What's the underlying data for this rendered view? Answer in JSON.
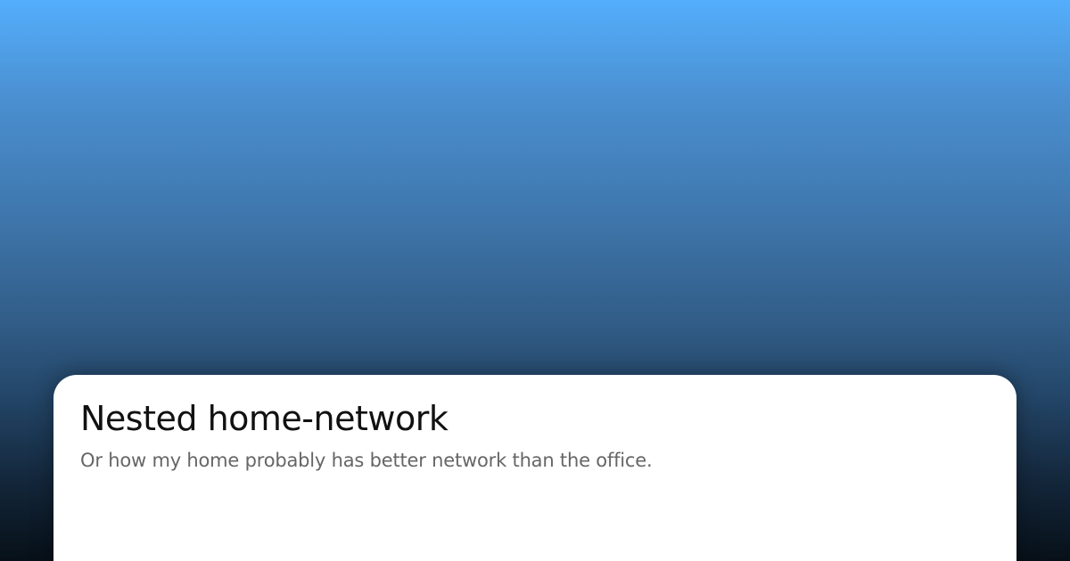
{
  "card": {
    "title": "Nested home-network",
    "subtitle": "Or how my home probably has better network than the office."
  },
  "colors": {
    "gradient_top": "#54aefc",
    "gradient_bottom": "#071018",
    "card_background": "#ffffff",
    "title_text": "#111111",
    "subtitle_text": "#666666"
  }
}
